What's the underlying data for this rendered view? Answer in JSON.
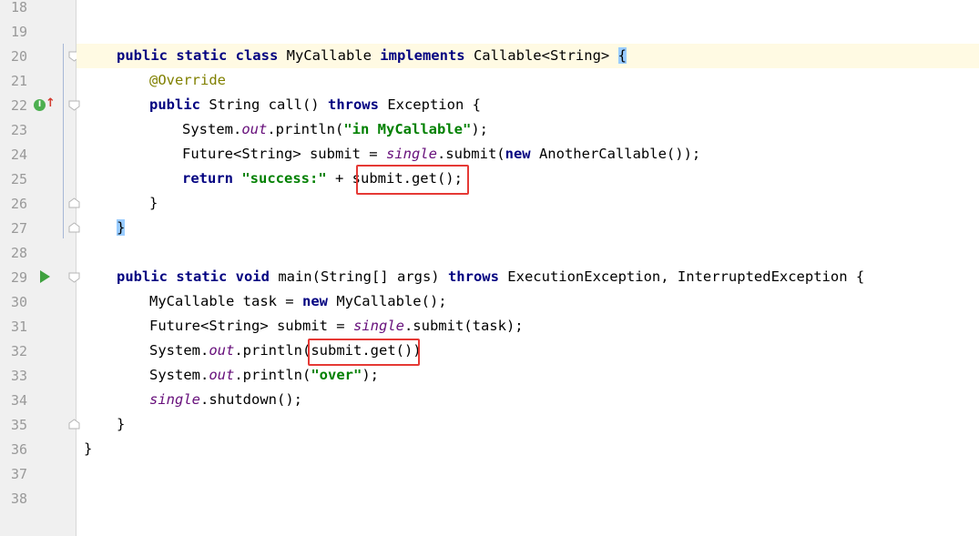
{
  "editor": {
    "line_numbers": [
      "18",
      "19",
      "20",
      "21",
      "22",
      "23",
      "24",
      "25",
      "26",
      "27",
      "28",
      "29",
      "30",
      "31",
      "32",
      "33",
      "34",
      "35",
      "36",
      "37",
      "38"
    ],
    "gutter_icons": {
      "implements_marker": "I",
      "override_arrow": "↑"
    },
    "code": {
      "l20": {
        "t1": "public static class ",
        "t2": "MyCallable ",
        "t3": "implements ",
        "t4": "Callable<String> ",
        "t5": "{"
      },
      "l21": {
        "t1": "@Override"
      },
      "l22": {
        "t1": "public ",
        "t2": "String call() ",
        "t3": "throws ",
        "t4": "Exception {"
      },
      "l23": {
        "t1": "System.",
        "t2": "out",
        "t3": ".println(",
        "t4": "\"in MyCallable\"",
        "t5": ");"
      },
      "l24": {
        "t1": "Future<String> submit = ",
        "t2": "single",
        "t3": ".submit(",
        "t4": "new ",
        "t5": "AnotherCallable());"
      },
      "l25": {
        "t1": "return ",
        "t2": "\"success:\"",
        "t3": " + ",
        "t4": "submit.get();"
      },
      "l26": {
        "t1": "}"
      },
      "l27": {
        "t1": "}"
      },
      "l29": {
        "t1": "public static void ",
        "t2": "main(String[] args) ",
        "t3": "throws ",
        "t4": "ExecutionException, InterruptedException {"
      },
      "l30": {
        "t1": "MyCallable task = ",
        "t2": "new ",
        "t3": "MyCallable();"
      },
      "l31": {
        "t1": "Future<String> submit = ",
        "t2": "single",
        "t3": ".submit(task);"
      },
      "l32": {
        "t1": "System.",
        "t2": "out",
        "t3": ".println(",
        "t4": "submit.get())"
      },
      "l33": {
        "t1": "System.",
        "t2": "out",
        "t3": ".println(",
        "t4": "\"over\"",
        "t5": ");"
      },
      "l34": {
        "t1": "single",
        "t2": ".shutdown();"
      },
      "l35": {
        "t1": "}"
      },
      "l36": {
        "t1": "}"
      }
    },
    "colors": {
      "keyword": "#000080",
      "string": "#008000",
      "annotation": "#808000",
      "static_field": "#660e7a",
      "highlight_box": "#e53935",
      "current_line": "#fffae3"
    }
  }
}
